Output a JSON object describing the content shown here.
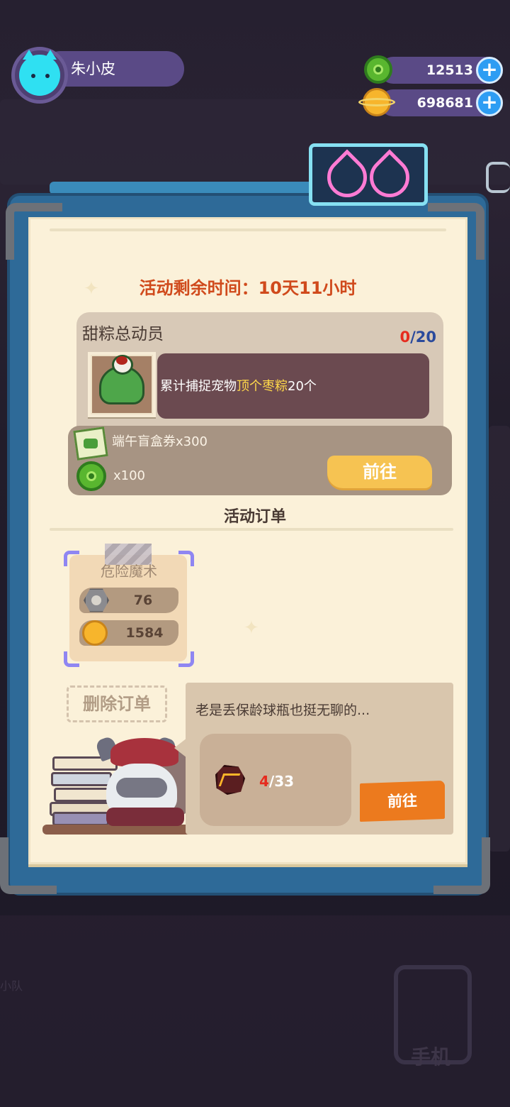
{
  "player": {
    "name": "朱小皮"
  },
  "currencies": {
    "gems": "12513",
    "coins": "698681",
    "plus_symbol": "+"
  },
  "event": {
    "timer_text": "活动剩余时间：10天11小时"
  },
  "task": {
    "title": "甜粽总动员",
    "progress_current": "0",
    "progress_total": "/20",
    "desc_prefix": "累计捕捉宠物",
    "desc_highlight": "顶个枣粽",
    "desc_suffix": "20个",
    "rewards": [
      {
        "icon": "blind-box-ticket-icon",
        "text": "端午盲盒券x300"
      },
      {
        "icon": "green-gem-icon",
        "text": "x100"
      }
    ],
    "go_label": "前往"
  },
  "orders": {
    "section_title": "活动订单",
    "card": {
      "title": "危险魔术",
      "rows": [
        {
          "icon": "nut-icon",
          "value": "76"
        },
        {
          "icon": "coin-icon",
          "value": "1584"
        }
      ]
    },
    "delete_label": "删除订单"
  },
  "quest": {
    "speech": "老是丢保龄球瓶也挺无聊的...",
    "item_icon": "lava-rock-icon",
    "item_current": "4",
    "item_total": "/33",
    "go_label": "前往"
  },
  "background": {
    "phone_label": "手机",
    "left_label": "小队"
  },
  "colors": {
    "accent_orange": "#ec7a1e",
    "timer_red": "#d04a1c",
    "go_yellow": "#f6c352",
    "paper": "#fbf1d9",
    "board_blue": "#2e6a98"
  }
}
